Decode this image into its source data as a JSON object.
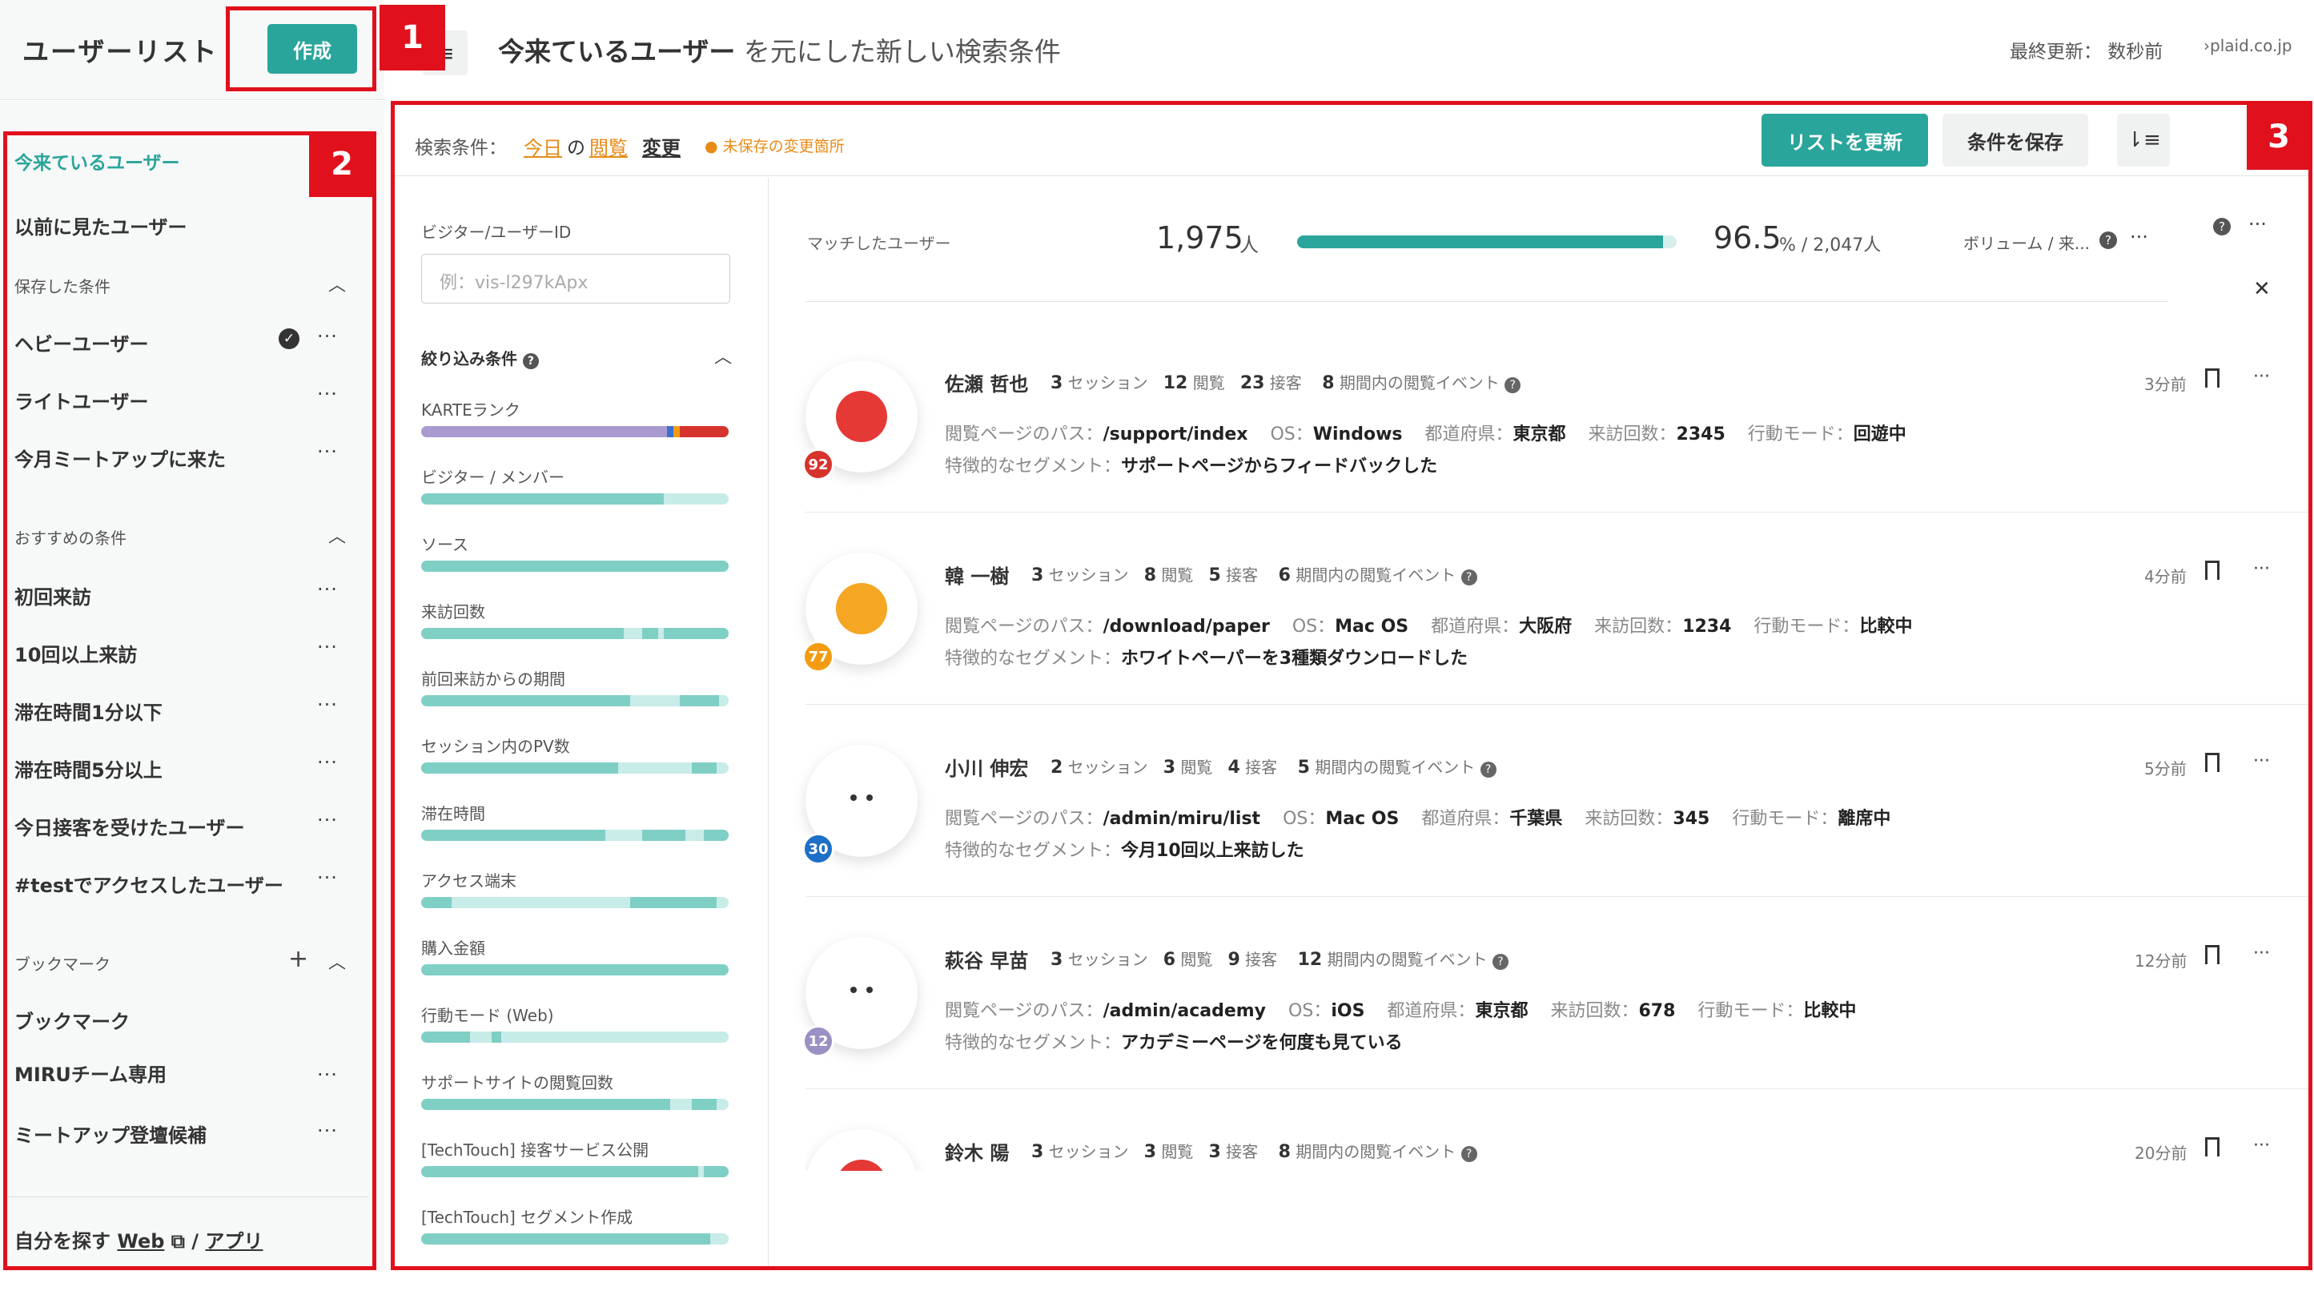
{
  "sidebar": {
    "brand": "ユーザーリスト",
    "create_label": "作成",
    "items": [
      {
        "label": "今来ているユーザー"
      },
      {
        "label": "以前に見たユーザー"
      }
    ],
    "saved": {
      "title": "保存した条件",
      "items": [
        {
          "label": "ヘビーユーザー"
        },
        {
          "label": "ライトユーザー"
        },
        {
          "label": "今月ミートアップに来た"
        }
      ]
    },
    "recommended": {
      "title": "おすすめの条件",
      "items": [
        {
          "label": "初回来訪"
        },
        {
          "label": "10回以上来訪"
        },
        {
          "label": "滞在時間1分以下"
        },
        {
          "label": "滞在時間5分以上"
        },
        {
          "label": "今日接客を受けたユーザー"
        },
        {
          "label": "#testでアクセスしたユーザー"
        }
      ]
    },
    "bookmarks": {
      "title": "ブックマーク",
      "items": [
        {
          "label": "ブックマーク"
        },
        {
          "label": "MIRUチーム専用"
        },
        {
          "label": "ミートアップ登壇候補"
        }
      ]
    },
    "footer": {
      "prefix": "自分を探す",
      "web": "Web",
      "sep": "/",
      "app": "アプリ"
    },
    "dots": "···"
  },
  "header": {
    "title_bold": "今来ているユーザー",
    "title_rest": "を元にした新しい検索条件",
    "last_update": "最終更新： 数秒前",
    "domain": "›plaid.co.jp"
  },
  "annotations": [
    "1",
    "2",
    "3"
  ],
  "conditions": {
    "label": "検索条件：",
    "today": "今日",
    "no": "の",
    "view": "閲覧",
    "change": "変更",
    "unsaved": "● 未保存の変更箇所",
    "refresh": "リストを更新",
    "save": "条件を保存"
  },
  "filters": {
    "id_label": "ビジター/ユーザーID",
    "id_placeholder": "例：vis-l297kApx",
    "title": "絞り込み条件",
    "items": [
      {
        "label": "KARTEランク"
      },
      {
        "label": "ビジター / メンバー"
      },
      {
        "label": "ソース"
      },
      {
        "label": "来訪回数"
      },
      {
        "label": "前回来訪からの期間"
      },
      {
        "label": "セッション内のPV数"
      },
      {
        "label": "滞在時間"
      },
      {
        "label": "アクセス端末"
      },
      {
        "label": "購入金額"
      },
      {
        "label": "行動モード (Web)"
      },
      {
        "label": "サポートサイトの閲覧回数"
      },
      {
        "label": "[TechTouch] 接客サービス公開"
      },
      {
        "label": "[TechTouch] セグメント作成"
      }
    ]
  },
  "stats": {
    "match_label": "マッチしたユーザー",
    "count": "1,975",
    "unit": "人",
    "pct": "96.5",
    "pct_rest": "% / 2,047人",
    "fill": 0.965,
    "volume": "ボリューム / 来..."
  },
  "users": [
    {
      "name": "佐瀬 哲也",
      "sessions": "3",
      "views": "12",
      "serves": "23",
      "events": "8",
      "score": "92",
      "score_color": "#d6332c",
      "path": "/support/index",
      "os": "Windows",
      "pref": "東京都",
      "visits": "2345",
      "mode": "回遊中",
      "segment": "サポートページからフィードバックした",
      "time": "3分前",
      "face": "#e53935"
    },
    {
      "name": "韓 一樹",
      "sessions": "3",
      "views": "8",
      "serves": "5",
      "events": "6",
      "score": "77",
      "score_color": "#f39c12",
      "path": "/download/paper",
      "os": "Mac OS",
      "pref": "大阪府",
      "visits": "1234",
      "mode": "比較中",
      "segment": "ホワイトペーパーを3種類ダウンロードした",
      "time": "4分前",
      "face": "#f5a623"
    },
    {
      "name": "小川 伸宏",
      "sessions": "2",
      "views": "3",
      "serves": "4",
      "events": "5",
      "score": "30",
      "score_color": "#1e6fc6",
      "path": "/admin/miru/list",
      "os": "Mac OS",
      "pref": "千葉県",
      "visits": "345",
      "mode": "離席中",
      "segment": "今月10回以上来訪した",
      "time": "5分前",
      "face": "#ffffff"
    },
    {
      "name": "萩谷 早苗",
      "sessions": "3",
      "views": "6",
      "serves": "9",
      "events": "12",
      "score": "12",
      "score_color": "#9b8fc4",
      "path": "/admin/academy",
      "os": "iOS",
      "pref": "東京都",
      "visits": "678",
      "mode": "比較中",
      "segment": "アカデミーページを何度も見ている",
      "time": "12分前",
      "face": "#ffffff"
    },
    {
      "name": "鈴木 陽",
      "sessions": "3",
      "views": "3",
      "serves": "3",
      "events": "8",
      "score": "",
      "score_color": "#d6332c",
      "path": "",
      "os": "",
      "pref": "",
      "visits": "",
      "mode": "",
      "segment": "",
      "time": "20分前",
      "face": "#e53935"
    }
  ],
  "labels": {
    "sessions": "セッション",
    "views": "閲覧",
    "serves": "接客",
    "events": "期間内の閲覧イベント",
    "path": "閲覧ページのパス：",
    "os": "OS：",
    "pref": "都道府県：",
    "visits": "来訪回数：",
    "mode": "行動モード：",
    "segment": "特徴的なセグメント："
  }
}
